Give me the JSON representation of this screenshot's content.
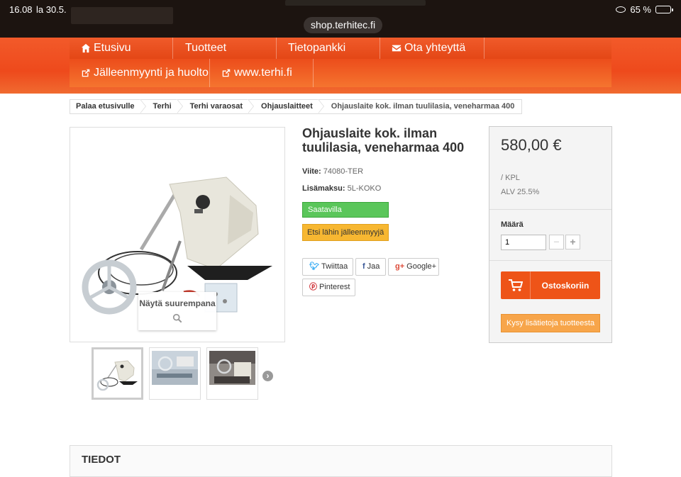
{
  "status_bar": {
    "time": "16.08",
    "date": "la 30.5.",
    "battery": "65 %"
  },
  "browser": {
    "url": "shop.terhitec.fi"
  },
  "nav": {
    "row1": [
      {
        "label": "Etusivu",
        "icon": "home-icon"
      },
      {
        "label": "Tuotteet",
        "icon": ""
      },
      {
        "label": "Tietopankki",
        "icon": ""
      },
      {
        "label": "Ota yhteyttä",
        "icon": "envelope-icon"
      }
    ],
    "row2": [
      {
        "label": "Jälleenmyynti ja huolto",
        "icon": "external-link-icon"
      },
      {
        "label": "www.terhi.fi",
        "icon": "external-link-icon"
      }
    ]
  },
  "breadcrumb": [
    "Palaa etusivulle",
    "Terhi",
    "Terhi varaosat",
    "Ohjauslaitteet",
    "Ohjauslaite kok. ilman tuulilasia, veneharmaa 400"
  ],
  "product": {
    "title": "Ohjauslaite kok. ilman tuulilasia, veneharmaa 400",
    "ref_label": "Viite:",
    "ref_value": "74080-TER",
    "extra_label": "Lisämaksu:",
    "extra_value": "5L-KOKO",
    "availability": "Saatavilla",
    "dealer_button": "Etsi lähin jälleenmyyjä",
    "zoom_label": "Näytä suurempana"
  },
  "share": {
    "twitter": "Twiittaa",
    "facebook": "Jaa",
    "google": "Google+",
    "pinterest": "Pinterest"
  },
  "buybox": {
    "price": "580,00 €",
    "unit": "/ KPL",
    "vat": "ALV 25.5%",
    "qty_label": "Määrä",
    "qty_value": "1",
    "cart_button": "Ostoskoriin",
    "ask_button": "Kysy lisätietoja tuotteesta"
  },
  "details": {
    "heading": "TIEDOT"
  },
  "colors": {
    "brand_orange": "#ee5418",
    "available_green": "#5ac65a",
    "dealer_yellow": "#f7b731",
    "ask_orange": "#f7a54a"
  }
}
